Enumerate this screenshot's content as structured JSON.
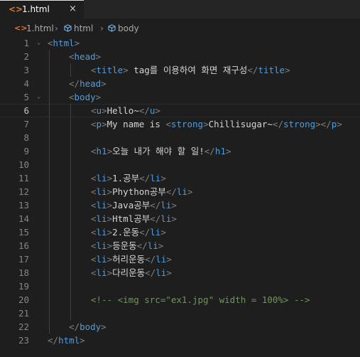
{
  "tab": {
    "icon": "<>",
    "label": "1.html",
    "close": "×"
  },
  "breadcrumb": {
    "file_icon": "<>",
    "file": "1.html",
    "sep": "›",
    "item1": "html",
    "item2": "body"
  },
  "editor": {
    "current_line": 6,
    "lines": [
      {
        "n": "1",
        "fold": "⌄"
      },
      {
        "n": "2"
      },
      {
        "n": "3"
      },
      {
        "n": "4"
      },
      {
        "n": "5",
        "fold": "⌄"
      },
      {
        "n": "6"
      },
      {
        "n": "7"
      },
      {
        "n": "8"
      },
      {
        "n": "9"
      },
      {
        "n": "10"
      },
      {
        "n": "11"
      },
      {
        "n": "12"
      },
      {
        "n": "13"
      },
      {
        "n": "14"
      },
      {
        "n": "15"
      },
      {
        "n": "16"
      },
      {
        "n": "17"
      },
      {
        "n": "18"
      },
      {
        "n": "19"
      },
      {
        "n": "20"
      },
      {
        "n": "21"
      },
      {
        "n": "22"
      },
      {
        "n": "23"
      }
    ],
    "tokens": {
      "l1_open": "<",
      "l1_tag": "html",
      "l1_close": ">",
      "l2_open": "<",
      "l2_tag": "head",
      "l2_close": ">",
      "l3_open": "<",
      "l3_tag": "title",
      "l3_close": ">",
      "l3_text": " tag를 이용하여 화면 재구성",
      "l3_open2": "</",
      "l3_tag2": "title",
      "l3_close2": ">",
      "l4_open": "</",
      "l4_tag": "head",
      "l4_close": ">",
      "l5_open": "<",
      "l5_tag": "body",
      "l5_close": ">",
      "l6_open": "<",
      "l6_tag": "u",
      "l6_close": ">",
      "l6_text": "Hello~",
      "l6_open2": "</",
      "l6_tag2": "u",
      "l6_close2": ">",
      "l7_a": "<",
      "l7_p": "p",
      "l7_b": ">",
      "l7_text1": "My name is ",
      "l7_c": "<",
      "l7_strong": "strong",
      "l7_d": ">",
      "l7_text2": "Chillisugar~",
      "l7_e": "</",
      "l7_strong2": "strong",
      "l7_f": ">",
      "l7_g": "</",
      "l7_p2": "p",
      "l7_h": ">",
      "l9_a": "<",
      "l9_tag": "h1",
      "l9_b": ">",
      "l9_text": "오늘 내가 해야 할 일!",
      "l9_c": "</",
      "l9_tag2": "h1",
      "l9_d": ">",
      "li_open": "<",
      "li_tag": "li",
      "li_close": ">",
      "li_end_open": "</",
      "li_items": [
        "1.공부",
        "Phython공부",
        "Java공부",
        "Html공부",
        "2.운동",
        "등운동",
        "허리운동",
        "다리운동"
      ],
      "l20_text": "<!-- <img src=\"ex1.jpg\" width = 100%> -->",
      "l22_open": "</",
      "l22_tag": "body",
      "l22_close": ">",
      "l23_open": "</",
      "l23_tag": "html",
      "l23_close": ">"
    }
  },
  "colors": {
    "background": "#1e1e1e",
    "tag": "#569cd6",
    "bracket": "#808080",
    "text": "#d4d4d4",
    "comment": "#6a9955",
    "line_number": "#858585",
    "html_icon": "#e37933"
  }
}
